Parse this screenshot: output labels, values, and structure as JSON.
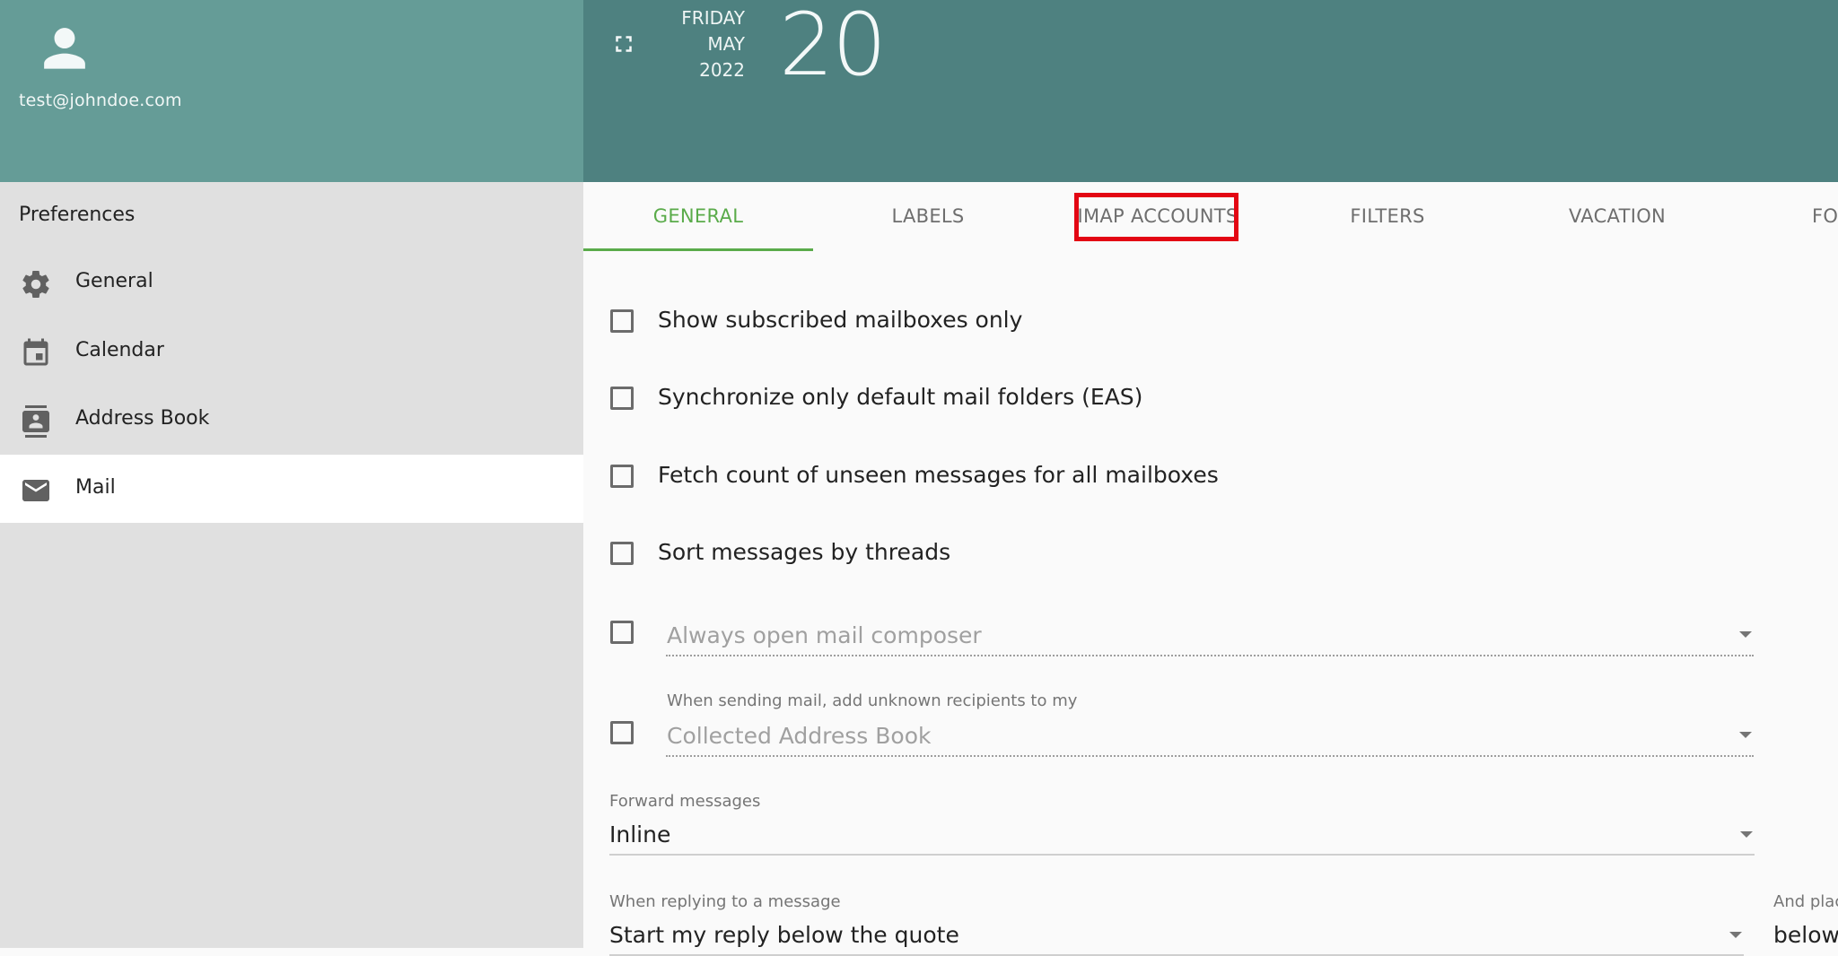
{
  "user": {
    "email": "test@johndoe.com"
  },
  "sidebar": {
    "title": "Preferences",
    "items": [
      {
        "label": "General",
        "icon": "gear-icon"
      },
      {
        "label": "Calendar",
        "icon": "calendar-icon"
      },
      {
        "label": "Address Book",
        "icon": "contacts-icon"
      },
      {
        "label": "Mail",
        "icon": "mail-icon",
        "selected": true
      }
    ]
  },
  "header": {
    "weekday": "FRIDAY",
    "month": "MAY",
    "year": "2022",
    "day": "20"
  },
  "tabs": [
    {
      "label": "GENERAL",
      "active": true
    },
    {
      "label": "LABELS"
    },
    {
      "label": "IMAP ACCOUNTS",
      "highlighted": true
    },
    {
      "label": "FILTERS"
    },
    {
      "label": "VACATION"
    },
    {
      "label": "FOR"
    }
  ],
  "settings": {
    "show_subscribed": {
      "label": "Show subscribed mailboxes only",
      "checked": false
    },
    "sync_default": {
      "label": "Synchronize only default mail folders (EAS)",
      "checked": false
    },
    "fetch_unseen": {
      "label": "Fetch count of unseen messages for all mailboxes",
      "checked": false
    },
    "sort_threads": {
      "label": "Sort messages by threads",
      "checked": false
    },
    "open_composer": {
      "value": "Always open mail composer",
      "checked": false
    },
    "unknown_recipients": {
      "label": "When sending mail, add unknown recipients to my",
      "value": "Collected Address Book",
      "checked": false
    },
    "forward": {
      "label": "Forward messages",
      "value": "Inline"
    },
    "reply": {
      "label": "When replying to a message",
      "value": "Start my reply below the quote"
    },
    "signature": {
      "label": "And plac",
      "value": "below"
    }
  },
  "colors": {
    "accent": "#5aab4a",
    "header": "#4e8180",
    "user_panel": "#659c97",
    "highlight": "#e30613"
  }
}
